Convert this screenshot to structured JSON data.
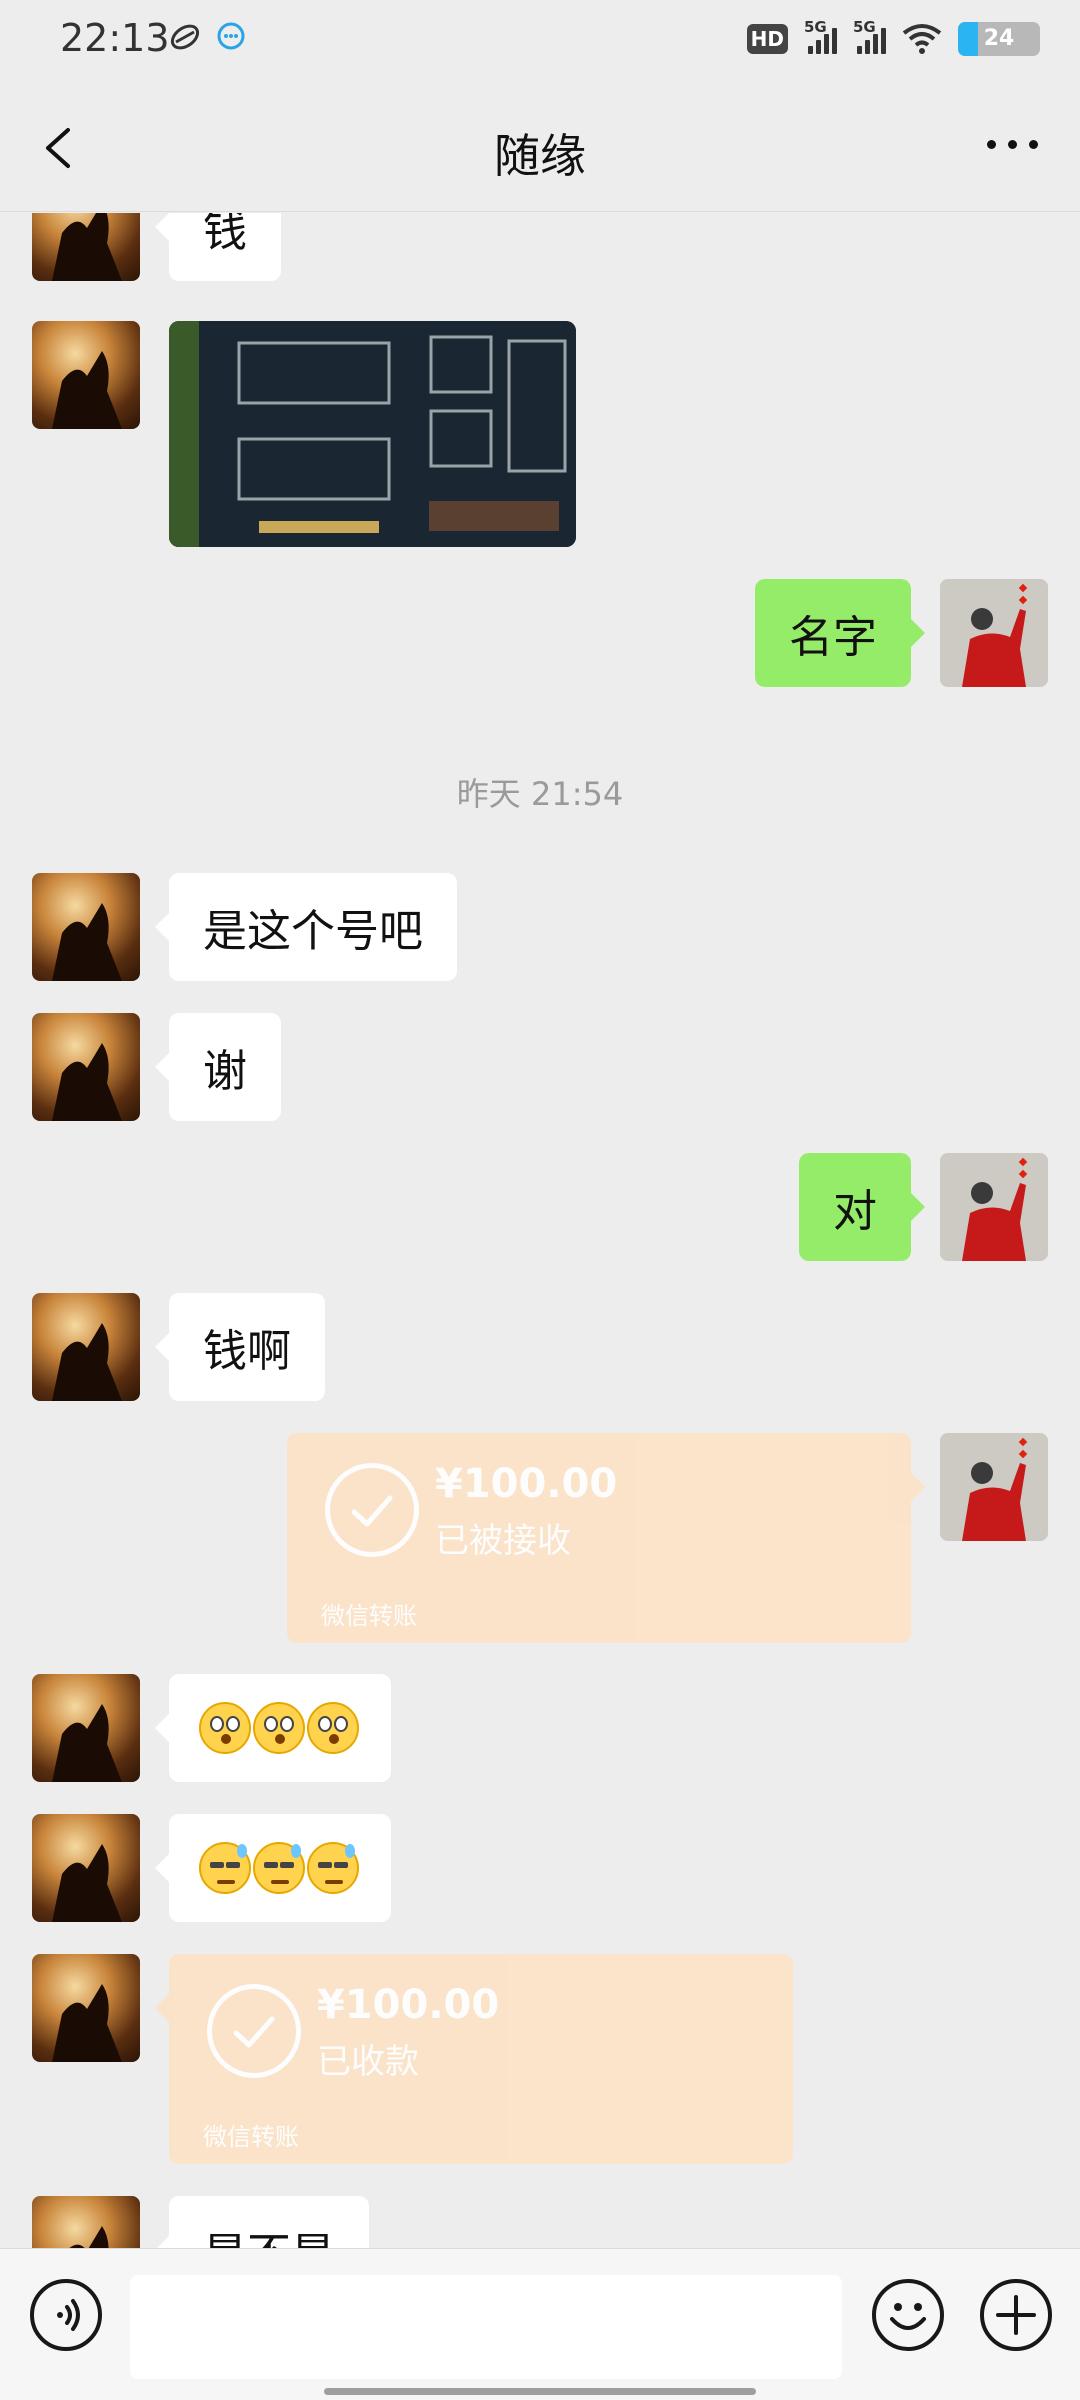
{
  "status_bar": {
    "time": "22:13",
    "battery": "24",
    "battery_level": 0.24,
    "network_1": "5G",
    "network_2": "5G",
    "hd_label": "HD"
  },
  "header": {
    "title": "随缘"
  },
  "messages": [
    {
      "side": "left",
      "type": "text",
      "text": "钱"
    },
    {
      "side": "left",
      "type": "image",
      "icon": "game-screenshot-image"
    },
    {
      "side": "right",
      "type": "text",
      "text": "名字"
    },
    {
      "type": "timestamp",
      "text": "昨天 21:54"
    },
    {
      "side": "left",
      "type": "text",
      "text": "是这个号吧"
    },
    {
      "side": "left",
      "type": "text",
      "text": "谢"
    },
    {
      "side": "right",
      "type": "text",
      "text": "对"
    },
    {
      "side": "left",
      "type": "text",
      "text": "钱啊"
    },
    {
      "side": "right",
      "type": "transfer",
      "amount": "¥100.00",
      "status": "已被接收",
      "footer": "微信转账"
    },
    {
      "side": "left",
      "type": "emoji",
      "emoji": "flushed-face-emoji",
      "count": 3
    },
    {
      "side": "left",
      "type": "emoji",
      "emoji": "sweat-face-emoji",
      "count": 3
    },
    {
      "side": "left",
      "type": "transfer",
      "amount": "¥100.00",
      "status": "已收款",
      "footer": "微信转账"
    },
    {
      "side": "left",
      "type": "text",
      "text": "是不是"
    }
  ],
  "colors": {
    "background": "#ededed",
    "sent_bubble": "#95ec69",
    "received_bubble": "#ffffff",
    "transfer": "#fde3c8"
  }
}
